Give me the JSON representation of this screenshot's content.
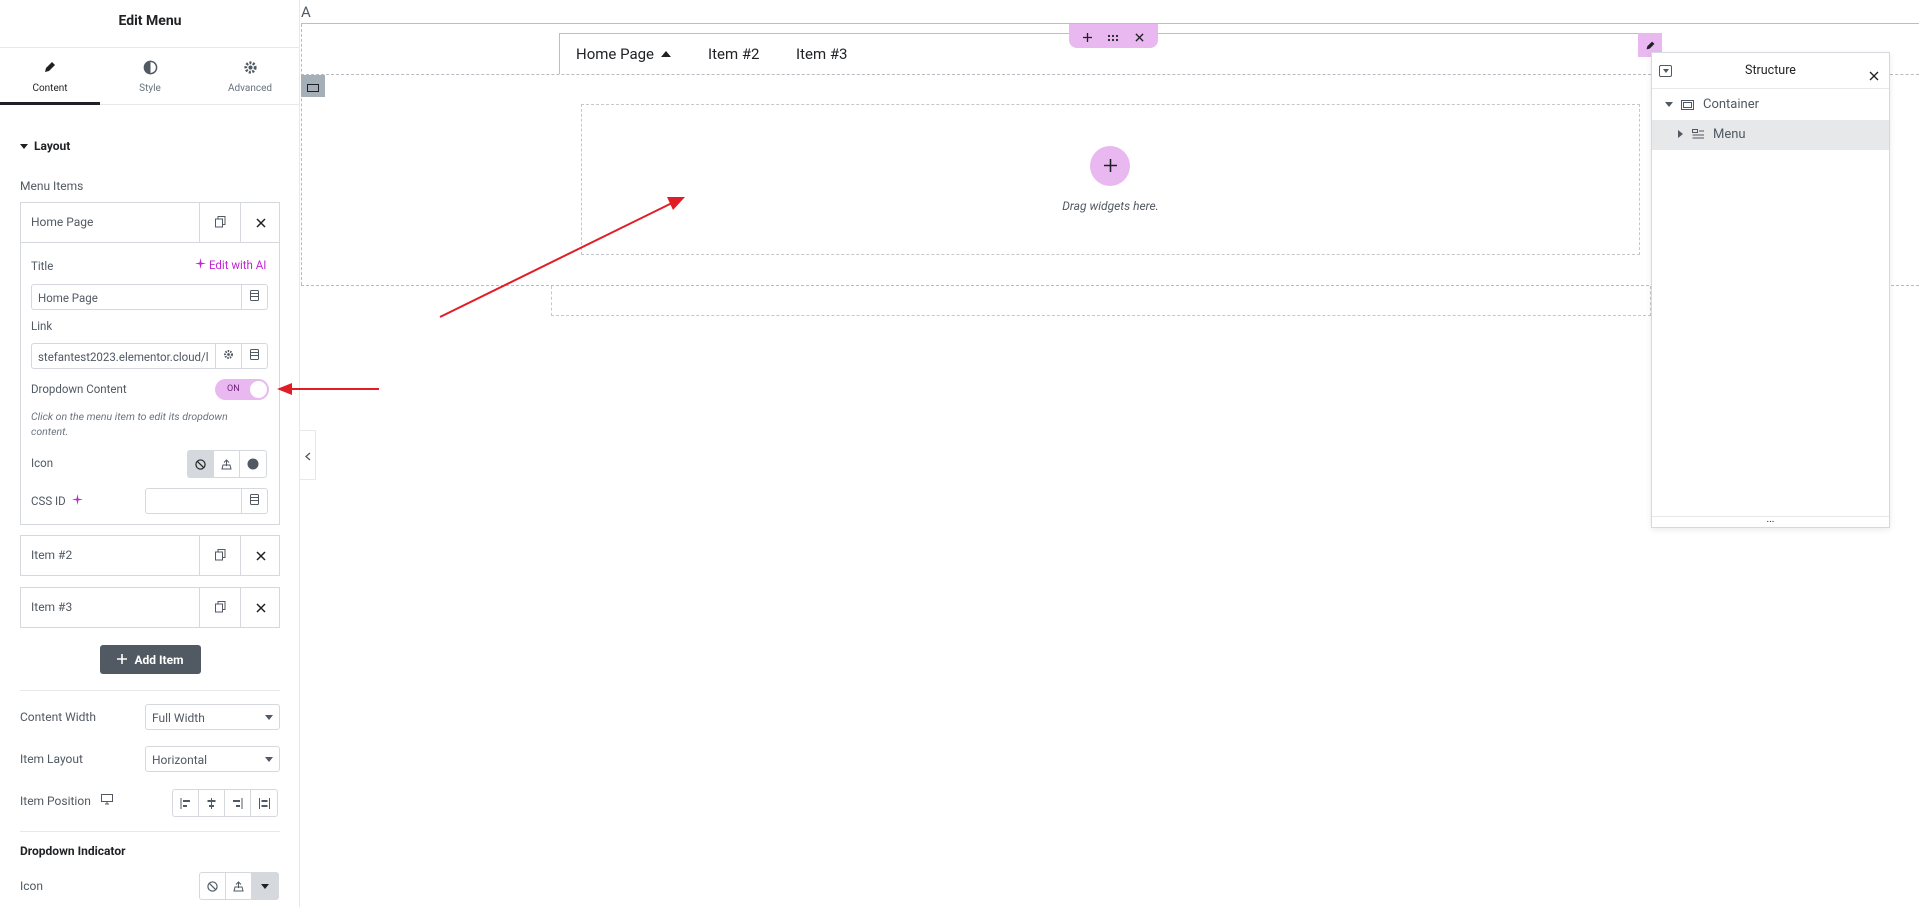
{
  "panel": {
    "title": "Edit Menu",
    "tabs": [
      {
        "label": "Content",
        "icon": "pencil-icon"
      },
      {
        "label": "Style",
        "icon": "contrast-icon"
      },
      {
        "label": "Advanced",
        "icon": "gear-icon"
      }
    ]
  },
  "layout": {
    "section_title": "Layout",
    "menu_items_label": "Menu Items",
    "items": [
      {
        "name": "Home Page"
      },
      {
        "name": "Item #2"
      },
      {
        "name": "Item #3"
      }
    ],
    "expanded": {
      "title_label": "Title",
      "edit_ai": "Edit with AI",
      "title_value": "Home Page",
      "link_label": "Link",
      "link_value": "stefantest2023.elementor.cloud/l",
      "dropdown_label": "Dropdown Content",
      "toggle_state": "ON",
      "hint": "Click on the menu item to edit its dropdown content.",
      "icon_label": "Icon",
      "css_id_label": "CSS ID",
      "css_id_value": ""
    },
    "add_item": "Add Item",
    "content_width_label": "Content Width",
    "content_width_value": "Full Width",
    "item_layout_label": "Item Layout",
    "item_layout_value": "Horizontal",
    "item_position_label": "Item Position",
    "dropdown_indicator_title": "Dropdown Indicator",
    "indicator_icon_label": "Icon"
  },
  "canvas": {
    "corner_letter": "A",
    "nav": [
      "Home Page",
      "Item #2",
      "Item #3"
    ],
    "drop_text": "Drag widgets here."
  },
  "structure": {
    "title": "Structure",
    "tree": [
      {
        "label": "Container"
      },
      {
        "label": "Menu"
      }
    ],
    "footer": "..."
  },
  "colors": {
    "accent": "#e9b8f0",
    "accent_dark": "#c026d3",
    "arrow": "#e11d26",
    "selection_outline": "#e79ff0"
  }
}
